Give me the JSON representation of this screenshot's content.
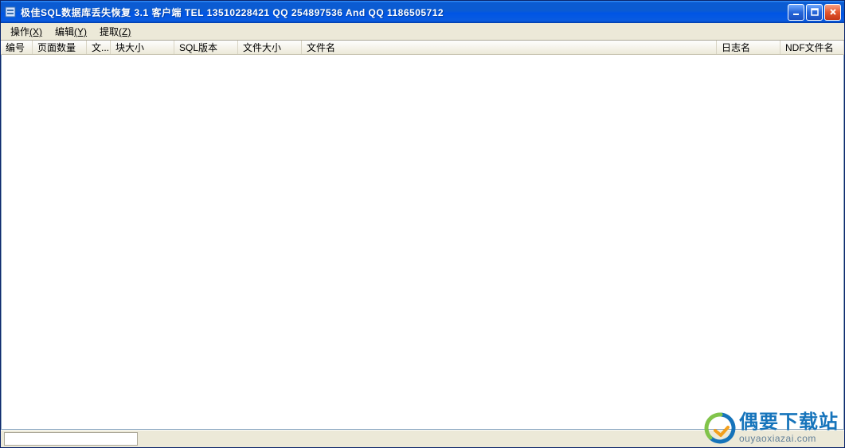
{
  "title": "极佳SQL数据库丢失恢复 3.1 客户端 TEL 13510228421 QQ 254897536 And QQ 1186505712",
  "menu": {
    "items": [
      {
        "label": "操作",
        "shortcut": "(X)"
      },
      {
        "label": "编辑",
        "shortcut": "(Y)"
      },
      {
        "label": "提取",
        "shortcut": "(Z)"
      }
    ]
  },
  "columns": [
    "编号",
    "页面数量",
    "文...",
    "块大小",
    "SQL版本",
    "文件大小",
    "文件名",
    "日志名",
    "NDF文件名"
  ],
  "watermark": {
    "cn": "偶要下载站",
    "en": "ouyaoxiazai.com"
  },
  "colors": {
    "titlebar_start": "#0b5bd2",
    "titlebar_end": "#0055e5",
    "close_btn": "#e3572e",
    "chrome_bg": "#ece9d8"
  }
}
